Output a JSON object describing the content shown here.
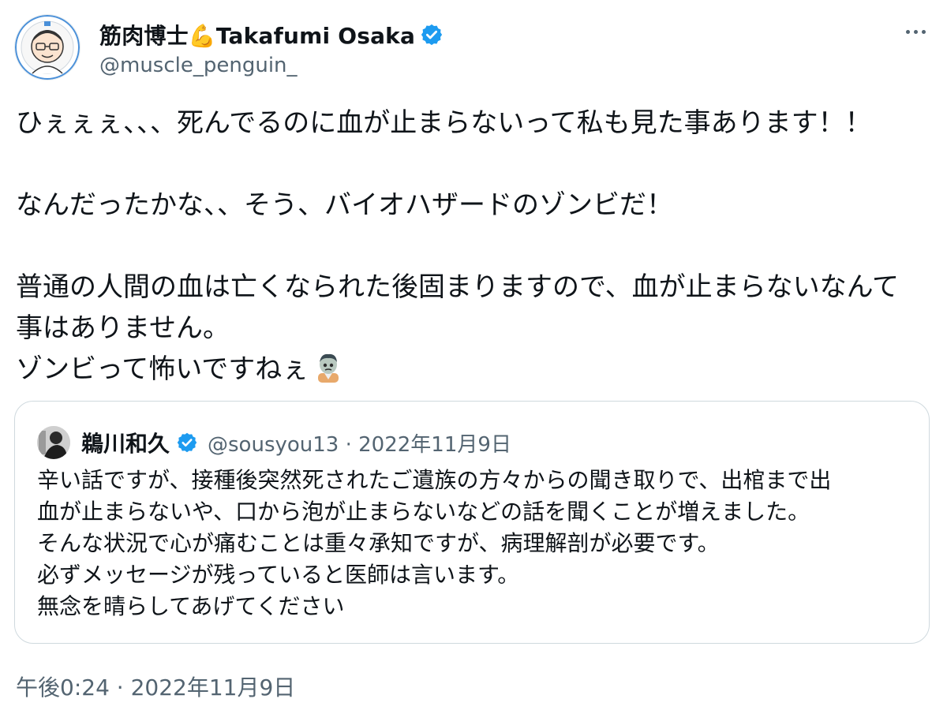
{
  "author": {
    "display_name": "筋肉博士💪Takafumi Osaka",
    "handle": "@muscle_penguin_",
    "verified_icon": "verified-badge-icon"
  },
  "menu": {
    "more_icon": "more-horizontal-icon"
  },
  "tweet": {
    "paragraphs": [
      "ひぇぇぇ、、、死んでるのに血が止まらないって私も見た事あります！！",
      "",
      "なんだったかな、、そう、バイオハザードのゾンビだ！",
      "",
      "普通の人間の血は亡くなられた後固まりますので、血が止まらないなんて",
      "事はありません。",
      "ゾンビって怖いですねぇ"
    ],
    "emoji": "zombie-emoji-icon"
  },
  "quote": {
    "display_name": "鵜川和久",
    "meta": "@sousyou13 · 2022年11月9日",
    "lines": [
      "辛い話ですが、接種後突然死されたご遺族の方々からの聞き取りで、出棺まで出",
      "血が止まらないや、口から泡が止まらないなどの話を聞くことが増えました。",
      "そんな状況で心が痛むことは重々承知ですが、病理解剖が必要です。",
      "必ずメッセージが残っていると医師は言います。",
      "無念を晴らしてあげてください"
    ]
  },
  "timestamp": "午後0:24 · 2022年11月9日",
  "colors": {
    "verified": "#1d9bf0",
    "secondary_text": "#536471",
    "border": "#cfd9de"
  }
}
